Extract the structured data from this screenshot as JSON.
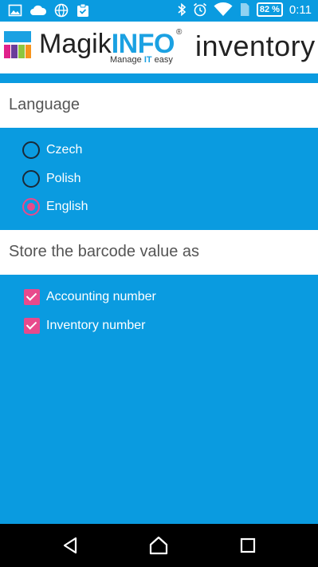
{
  "status_bar": {
    "icons_left": [
      "image-icon",
      "cloud-icon",
      "globe-icon",
      "clipboard-icon"
    ],
    "icons_right": [
      "bluetooth-icon",
      "alarm-icon",
      "wifi-icon",
      "sim-icon"
    ],
    "battery": "82 %",
    "time": "0:11"
  },
  "header": {
    "brand_part1": "Magik",
    "brand_part2": "INFO",
    "registered": "®",
    "tagline_part1": "Manage ",
    "tagline_part2": "IT",
    "tagline_part3": " easy",
    "product": "inventory"
  },
  "language": {
    "title": "Language",
    "options": [
      {
        "label": "Czech",
        "checked": false
      },
      {
        "label": "Polish",
        "checked": false
      },
      {
        "label": "English",
        "checked": true
      }
    ]
  },
  "barcode": {
    "title": "Store the barcode value as",
    "options": [
      {
        "label": "Accounting number",
        "checked": true
      },
      {
        "label": "Inventory number",
        "checked": true
      }
    ]
  },
  "colors": {
    "background": "#0a9be0",
    "accent": "#e84a8c",
    "brand_blue": "#1ba1e2"
  },
  "nav": {
    "icons": [
      "back-icon",
      "home-icon",
      "recents-icon"
    ]
  }
}
